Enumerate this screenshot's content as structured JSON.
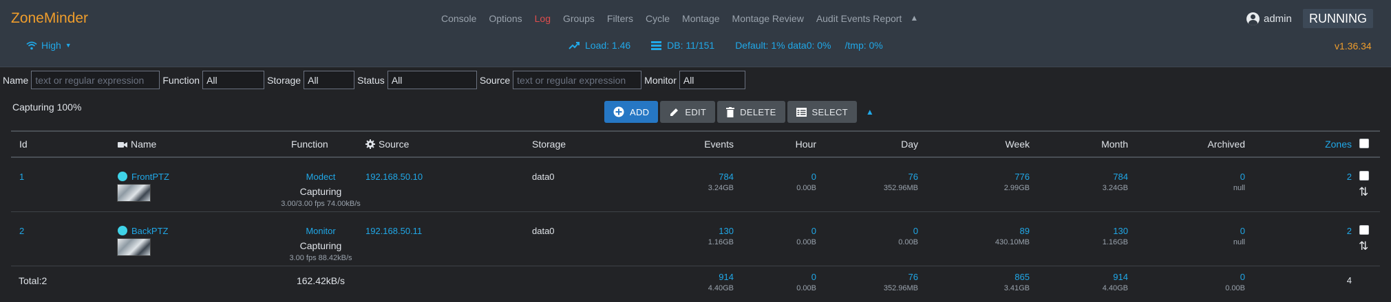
{
  "app": {
    "brand": "ZoneMinder",
    "version": "v1.36.34",
    "state": "RUNNING",
    "user": "admin",
    "quality": "High"
  },
  "menu": [
    {
      "label": "Console",
      "active": false
    },
    {
      "label": "Options",
      "active": false
    },
    {
      "label": "Log",
      "active": true
    },
    {
      "label": "Groups",
      "active": false
    },
    {
      "label": "Filters",
      "active": false
    },
    {
      "label": "Cycle",
      "active": false
    },
    {
      "label": "Montage",
      "active": false
    },
    {
      "label": "Montage Review",
      "active": false
    },
    {
      "label": "Audit Events Report",
      "active": false
    }
  ],
  "status": {
    "load": "Load: 1.46",
    "db": "DB: 11/151",
    "disk": "Default: 1% data0: 0%",
    "tmp": "/tmp: 0%"
  },
  "filters": {
    "name_label": "Name",
    "name_placeholder": "text or regular expression",
    "function_label": "Function",
    "function_value": "All",
    "storage_label": "Storage",
    "storage_value": "All",
    "status_label": "Status",
    "status_value": "All",
    "source_label": "Source",
    "source_placeholder": "text or regular expression",
    "monitor_label": "Monitor",
    "monitor_value": "All"
  },
  "capturing": "Capturing 100%",
  "actions": {
    "add": "ADD",
    "edit": "EDIT",
    "delete": "DELETE",
    "select": "SELECT"
  },
  "columns": {
    "id": "Id",
    "name": "Name",
    "function": "Function",
    "source": "Source",
    "storage": "Storage",
    "events": "Events",
    "hour": "Hour",
    "day": "Day",
    "week": "Week",
    "month": "Month",
    "archived": "Archived",
    "zones": "Zones"
  },
  "monitors": [
    {
      "id": "1",
      "name": "FrontPTZ",
      "function": "Modect",
      "status": "Capturing",
      "fps": "3.00/3.00 fps 74.00kB/s",
      "source": "192.168.50.10",
      "storage": "data0",
      "events": "784",
      "events_size": "3.24GB",
      "hour": "0",
      "hour_size": "0.00B",
      "day": "76",
      "day_size": "352.96MB",
      "week": "776",
      "week_size": "2.99GB",
      "month": "784",
      "month_size": "3.24GB",
      "archived": "0",
      "archived_size": "null",
      "zones": "2"
    },
    {
      "id": "2",
      "name": "BackPTZ",
      "function": "Monitor",
      "status": "Capturing",
      "fps": "3.00 fps 88.42kB/s",
      "source": "192.168.50.11",
      "storage": "data0",
      "events": "130",
      "events_size": "1.16GB",
      "hour": "0",
      "hour_size": "0.00B",
      "day": "0",
      "day_size": "0.00B",
      "week": "89",
      "week_size": "430.10MB",
      "month": "130",
      "month_size": "1.16GB",
      "archived": "0",
      "archived_size": "null",
      "zones": "2"
    }
  ],
  "totals": {
    "label": "Total:2",
    "bandwidth": "162.42kB/s",
    "events": "914",
    "events_size": "4.40GB",
    "hour": "0",
    "hour_size": "0.00B",
    "day": "76",
    "day_size": "352.96MB",
    "week": "865",
    "week_size": "3.41GB",
    "month": "914",
    "month_size": "4.40GB",
    "archived": "0",
    "archived_size": "0.00B",
    "zones": "4"
  },
  "colors": {
    "accent": "#20a8e8",
    "brand": "#ef9d2c",
    "log_active": "#e04d4d",
    "status_dot": "#3fd3e8",
    "navbar": "#323a44"
  }
}
